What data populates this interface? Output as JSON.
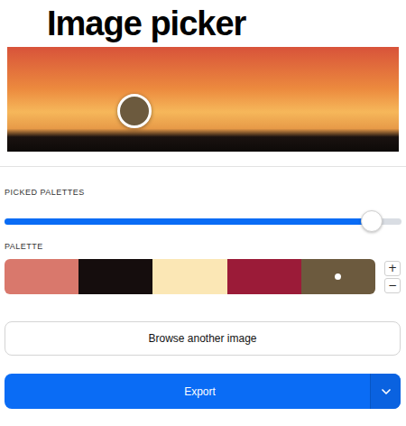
{
  "title": "Image picker",
  "image": {
    "has_picker": true
  },
  "picked_palettes": {
    "label": "PICKED PALETTES",
    "level": 0.925
  },
  "palette": {
    "label": "PALETTE",
    "swatches": [
      {
        "color": "#d9786c",
        "selected": false
      },
      {
        "color": "#150d0d",
        "selected": false
      },
      {
        "color": "#fbe7b5",
        "selected": false
      },
      {
        "color": "#9b1b38",
        "selected": false
      },
      {
        "color": "#6c5a3e",
        "selected": true
      }
    ],
    "add": "+",
    "remove": "−"
  },
  "browse_button": "Browse another image",
  "export_button": {
    "label": "Export"
  }
}
